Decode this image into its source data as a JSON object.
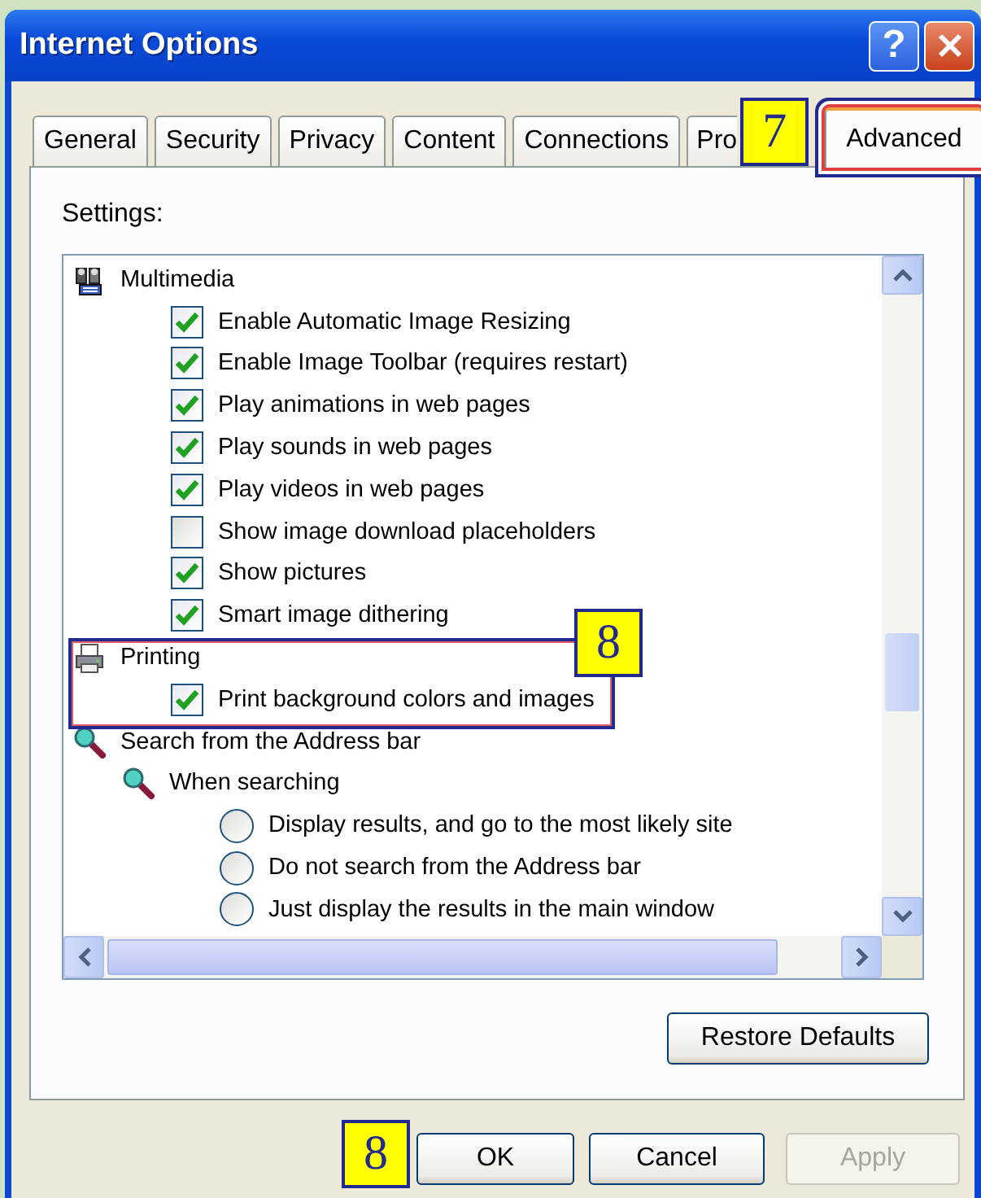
{
  "window": {
    "title": "Internet Options"
  },
  "title_buttons": [
    {
      "kind": "help",
      "label": "?"
    },
    {
      "kind": "close"
    }
  ],
  "tabs": [
    {
      "label": "General",
      "selected": false,
      "highlighted": false
    },
    {
      "label": "Security",
      "selected": false,
      "highlighted": false
    },
    {
      "label": "Privacy",
      "selected": false,
      "highlighted": false
    },
    {
      "label": "Content",
      "selected": false,
      "highlighted": false
    },
    {
      "label": "Connections",
      "selected": false,
      "highlighted": false
    },
    {
      "label": "Pro",
      "selected": false,
      "highlighted": false
    },
    {
      "label": "Advanced",
      "selected": true,
      "highlighted": true,
      "callout": "7"
    }
  ],
  "settings": {
    "label": "Settings:",
    "items": [
      {
        "kind": "media",
        "label": "Multimedia",
        "highlighted": false,
        "children": [
          {
            "kind": "checkbox",
            "label": "Enable Automatic Image Resizing",
            "checked": true
          },
          {
            "kind": "checkbox",
            "label": "Enable Image Toolbar (requires restart)",
            "checked": true
          },
          {
            "kind": "checkbox",
            "label": "Play animations in web pages",
            "checked": true
          },
          {
            "kind": "checkbox",
            "label": "Play sounds in web pages",
            "checked": true
          },
          {
            "kind": "checkbox",
            "label": "Play videos in web pages",
            "checked": true
          },
          {
            "kind": "checkbox",
            "label": "Show image download placeholders",
            "checked": false
          },
          {
            "kind": "checkbox",
            "label": "Show pictures",
            "checked": true
          },
          {
            "kind": "checkbox",
            "label": "Smart image dithering",
            "checked": true
          }
        ]
      },
      {
        "kind": "printer",
        "label": "Printing",
        "highlighted": true,
        "callout": "8",
        "children": [
          {
            "kind": "checkbox",
            "label": "Print background colors and images",
            "checked": true
          }
        ]
      },
      {
        "kind": "search",
        "label": "Search from the Address bar",
        "highlighted": false,
        "children": [
          {
            "kind": "search",
            "label": "When searching",
            "highlighted": false,
            "children": [
              {
                "kind": "radio",
                "label": "Display results, and go to the most likely site",
                "selected": false
              },
              {
                "kind": "radio",
                "label": "Do not search from the Address bar",
                "selected": false
              },
              {
                "kind": "radio",
                "label": "Just display the results in the main window",
                "selected": false
              }
            ]
          }
        ]
      }
    ]
  },
  "restore_button": "Restore Defaults",
  "buttons": [
    {
      "label": "OK",
      "disabled": false,
      "callout": "8"
    },
    {
      "label": "Cancel",
      "disabled": false
    },
    {
      "label": "Apply",
      "disabled": true
    }
  ]
}
